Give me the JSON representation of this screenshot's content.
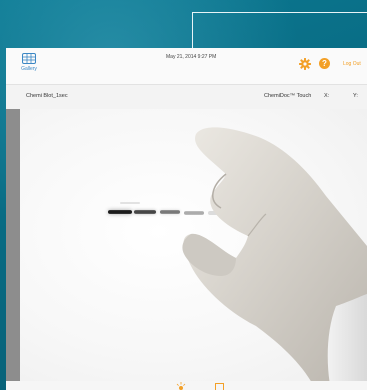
{
  "header": {
    "gallery_label": "Gallery",
    "datetime": "May 21, 2014 9:27 PM",
    "logout_label": "Log Out",
    "help_symbol": "?",
    "accent_color": "#f3a027",
    "link_color": "#3b87c4"
  },
  "infobar": {
    "image_name": "Chemi Blot_1sec",
    "device_name": "ChemiDoc™ Touch",
    "x_label": "X:",
    "y_label": "Y:"
  },
  "icons": {
    "gallery": "gallery-icon",
    "settings": "gear-icon",
    "help": "help-icon",
    "brightness": "brightness-icon",
    "frame": "frame-icon"
  }
}
